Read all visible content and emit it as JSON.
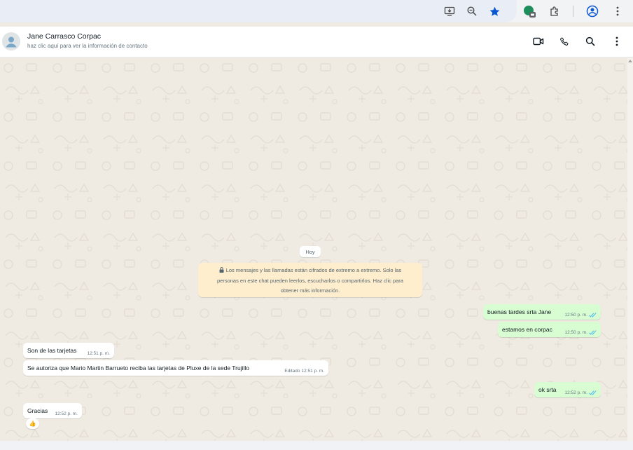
{
  "browser": {
    "icons": [
      "install-app-icon",
      "zoom-icon",
      "bookmark-star-icon",
      "extension-badge-icon",
      "extensions-puzzle-icon",
      "profile-icon",
      "menu-kebab-icon"
    ]
  },
  "header": {
    "contact_name": "Jane Carrasco Corpac",
    "contact_subtitle": "haz clic aquí para ver la información de contacto"
  },
  "chat": {
    "date_chip": "Hoy",
    "encryption_notice": {
      "line1": "Los mensajes y las llamadas están cifrados de extremo a extremo. Solo las",
      "line2": "personas en este chat pueden leerlos, escucharlos o compartirlos. Haz clic para",
      "line3": "obtener más información."
    },
    "messages": [
      {
        "dir": "out",
        "text": "buenas tardes srta Jane",
        "time": "12:50 p. m.",
        "status": "read"
      },
      {
        "dir": "out",
        "text": "estamos en corpac",
        "time": "12:50 p. m.",
        "status": "read"
      },
      {
        "dir": "in",
        "text": "Son de las tarjetas",
        "time": "12:51 p. m."
      },
      {
        "dir": "in",
        "text": "Se autoriza que Mario Martin Barrueto reciba las tarjetas de Pluxe de la sede Trujillo",
        "edited": "Editado",
        "time": "12:51 p. m."
      },
      {
        "dir": "out",
        "text": "ok srta",
        "time": "12:52 p. m.",
        "status": "read"
      },
      {
        "dir": "in",
        "text": "Gracias",
        "time": "12:52 p. m.",
        "reaction": "👍"
      }
    ]
  },
  "colors": {
    "outgoing_bubble": "#d9fdd3",
    "incoming_bubble": "#ffffff",
    "chat_background": "#efeae2",
    "read_tick": "#53bdeb",
    "encryption_notice_bg": "#ffeecd"
  }
}
